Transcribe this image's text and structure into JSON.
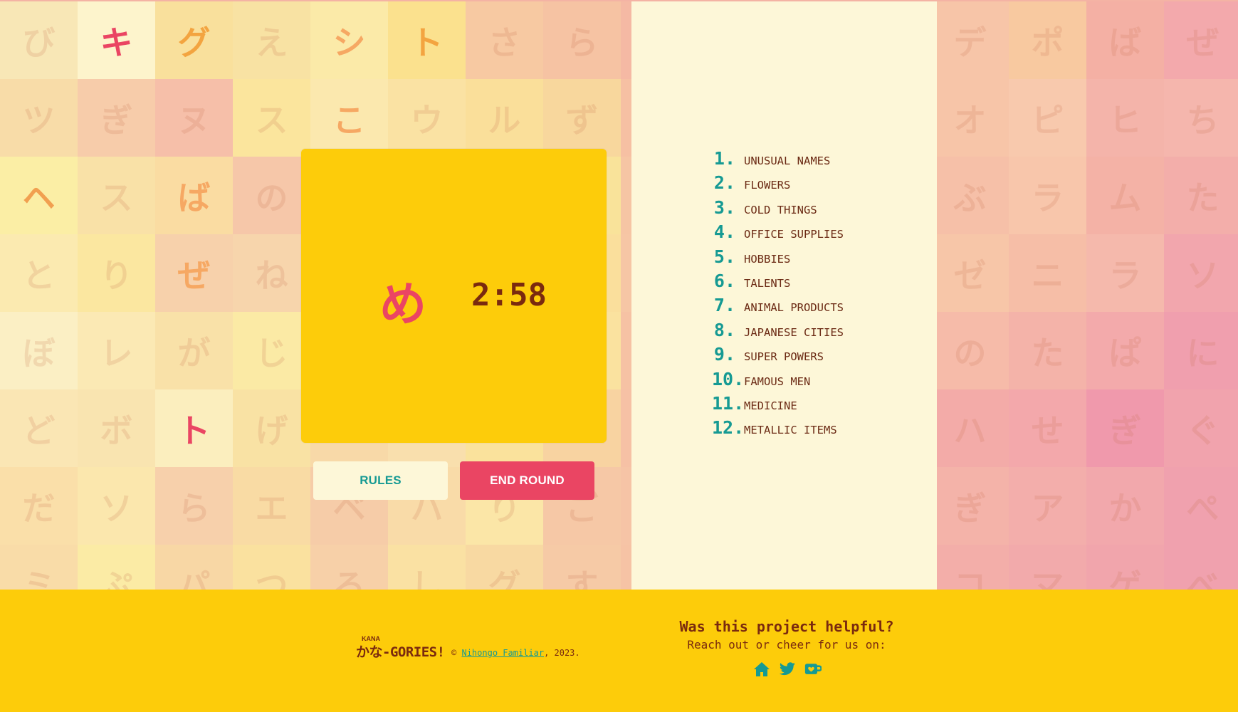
{
  "background": {
    "kana_rows": [
      [
        "び",
        "キ",
        "グ",
        "え",
        "シ",
        "ト",
        "さ",
        "ら",
        "",
        "",
        "",
        "",
        "デ",
        "ポ",
        "ば",
        "ぜ"
      ],
      [
        "ツ",
        "ぎ",
        "ヌ",
        "ス",
        "こ",
        "ウ",
        "ル",
        "ず",
        "",
        "",
        "",
        "",
        "オ",
        "ピ",
        "ヒ",
        "ち"
      ],
      [
        "ヘ",
        "ス",
        "ば",
        "の",
        "",
        "",
        "",
        "",
        "",
        "",
        "",
        "",
        "ぶ",
        "ラ",
        "ム",
        "た"
      ],
      [
        "と",
        "り",
        "ぜ",
        "ね",
        "",
        "",
        "",
        "",
        "",
        "",
        "",
        "",
        "ゼ",
        "ニ",
        "ラ",
        "ソ"
      ],
      [
        "ぼ",
        "レ",
        "が",
        "じ",
        "",
        "",
        "",
        "",
        "",
        "",
        "",
        "",
        "の",
        "た",
        "ぱ",
        "に"
      ],
      [
        "ど",
        "ボ",
        "ト",
        "げ",
        "",
        "",
        "",
        "",
        "",
        "",
        "",
        "",
        "ハ",
        "せ",
        "ぎ",
        "ぐ"
      ],
      [
        "だ",
        "ソ",
        "ら",
        "エ",
        "ベ",
        "ハ",
        "り",
        "ご",
        "",
        "",
        "",
        "",
        "ぎ",
        "ア",
        "か",
        "ぺ"
      ],
      [
        "ミ",
        "ぷ",
        "パ",
        "つ",
        "ろ",
        "し",
        "グ",
        "す",
        "",
        "",
        "",
        "",
        "コ",
        "マ",
        "ゲ",
        "べ"
      ]
    ]
  },
  "game": {
    "current_kana": "め",
    "timer": "2:58",
    "rules_label": "RULES",
    "end_round_label": "END ROUND"
  },
  "categories": [
    {
      "num": "1.",
      "label": "UNUSUAL NAMES"
    },
    {
      "num": "2.",
      "label": "FLOWERS"
    },
    {
      "num": "3.",
      "label": "COLD THINGS"
    },
    {
      "num": "4.",
      "label": "OFFICE SUPPLIES"
    },
    {
      "num": "5.",
      "label": "HOBBIES"
    },
    {
      "num": "6.",
      "label": "TALENTS"
    },
    {
      "num": "7.",
      "label": "ANIMAL PRODUCTS"
    },
    {
      "num": "8.",
      "label": "JAPANESE CITIES"
    },
    {
      "num": "9.",
      "label": "SUPER POWERS"
    },
    {
      "num": "10.",
      "label": "FAMOUS MEN"
    },
    {
      "num": "11.",
      "label": "MEDICINE"
    },
    {
      "num": "12.",
      "label": "METALLIC ITEMS"
    }
  ],
  "footer": {
    "logo_small": "KANA",
    "logo_main": "かな-GORIES!",
    "copyright_symbol": "©",
    "copyright_link": "Nihongo Familiar",
    "copyright_year": ", 2023.",
    "helpful_title": "Was this project helpful?",
    "helpful_sub": "Reach out or cheer for us on:",
    "icons": [
      "home-icon",
      "twitter-icon",
      "kofi-cup-icon"
    ]
  },
  "colors": {
    "card_yellow": "#fdcc0a",
    "cream": "#fdf7d8",
    "accent_red": "#ea4563",
    "teal": "#169a93",
    "brown": "#7a2a0f"
  }
}
